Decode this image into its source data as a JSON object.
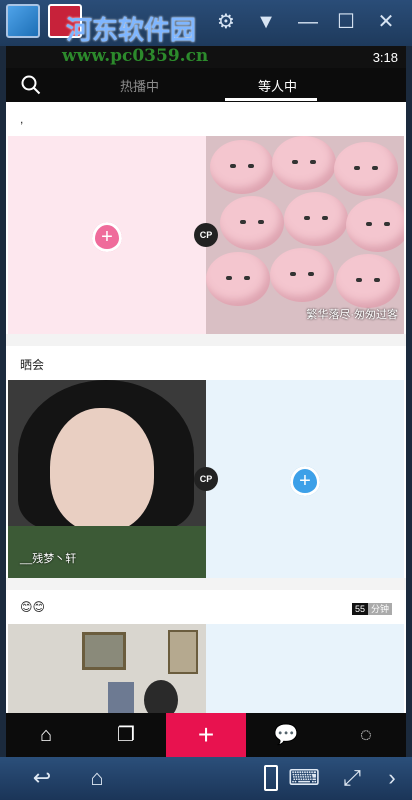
{
  "watermark": {
    "title": "河东软件园",
    "url": "www.pc0359.cn"
  },
  "status": {
    "time": "3:18"
  },
  "tabs": {
    "hot": "热播中",
    "waiting": "等人中"
  },
  "cards": [
    {
      "title": ",",
      "right_caption": "繁华落尽·匆匆过客",
      "cp": "CP",
      "add": "+"
    },
    {
      "title": "晒会",
      "left_caption": "__残梦丶轩",
      "cp": "CP",
      "add": "+"
    },
    {
      "title": "😊😊",
      "badge_count": "55",
      "badge_unit": "分钟"
    }
  ],
  "bottom_nav": {
    "add": "+"
  },
  "colors": {
    "accent": "#e8124f",
    "pink_drop": "#ef6b9b",
    "blue_drop": "#3da0e8"
  }
}
